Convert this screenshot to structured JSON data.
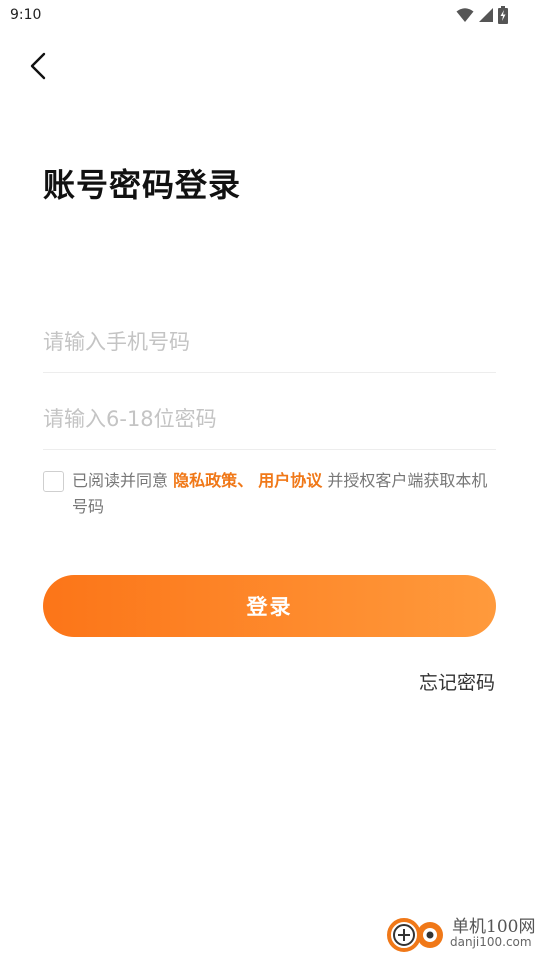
{
  "status_bar": {
    "time": "9:10"
  },
  "header": {
    "title": "账号密码登录"
  },
  "form": {
    "phone_placeholder": "请输入手机号码",
    "password_placeholder": "请输入6-18位密码"
  },
  "agreement": {
    "prefix": "已阅读并同意",
    "privacy_link": "隐私政策、",
    "user_agreement_link": "用户协议",
    "suffix": "并授权客户端获取本机号码"
  },
  "actions": {
    "login_label": "登录",
    "forgot_password_label": "忘记密码"
  },
  "watermark": {
    "name": "单机100网",
    "domain": "danji100.com"
  },
  "colors": {
    "accent": "#f07818",
    "button_gradient_start": "#fc7518",
    "button_gradient_end": "#ff9a3c"
  }
}
